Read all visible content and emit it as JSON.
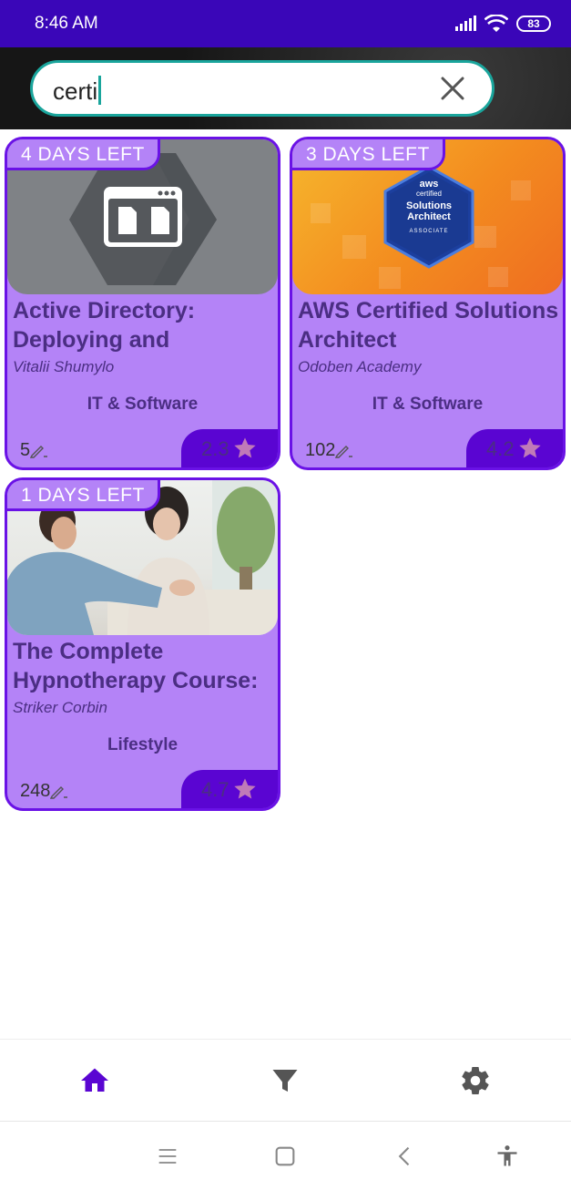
{
  "status_bar": {
    "time": "8:46 AM",
    "battery": "83"
  },
  "search": {
    "query": "certi"
  },
  "cards": [
    {
      "days_left": "4 DAYS LEFT",
      "title": "Active Directory: Deploying and",
      "author": "Vitalii Shumylo",
      "category": "IT & Software",
      "reviews": "5",
      "rating": "2.3"
    },
    {
      "days_left": "3 DAYS LEFT",
      "title": "AWS Certified Solutions Architect",
      "author": "Odoben Academy",
      "category": "IT & Software",
      "reviews": "102",
      "rating": "4.2",
      "badge": {
        "brand": "aws",
        "line1": "certified",
        "line2": "Solutions",
        "line3": "Architect",
        "line4": "ASSOCIATE"
      }
    },
    {
      "days_left": "1 DAYS LEFT",
      "title": "The Complete Hypnotherapy Course:",
      "author": "Striker Corbin",
      "category": "Lifestyle",
      "reviews": "248",
      "rating": "4.7"
    }
  ],
  "colors": {
    "status_bar": "#3a06b8",
    "card_bg": "#b483f7",
    "card_border": "#6a12e6",
    "rating_tab": "#5a05d2",
    "accent_teal": "#1aa59c",
    "nav_active": "#5a05d2",
    "star": "#c07ab8"
  },
  "icons": {
    "nav": [
      "home-icon",
      "filter-icon",
      "settings-icon"
    ],
    "system": [
      "menu-icon",
      "home-square-icon",
      "back-icon",
      "accessibility-icon"
    ]
  }
}
